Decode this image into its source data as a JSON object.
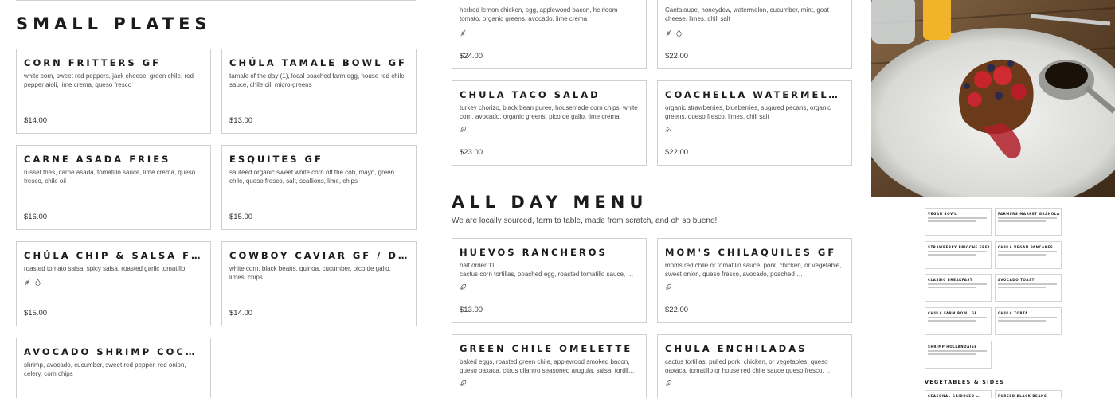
{
  "left_column": {
    "section_title": "SMALL PLATES",
    "items": [
      {
        "name": "CORN FRITTERS GF",
        "desc": "white corn, sweet red peppers, jack cheese, green chile, red pepper aioli, lime crema, queso fresco",
        "price": "$14.00"
      },
      {
        "name": "CHÚLA TAMALE BOWL  GF",
        "desc": "tamale of the day (1), local poached farm egg, house red chile sauce, chile oil, micro-greens",
        "price": "$13.00"
      },
      {
        "name": "CARNE ASADA FRIES",
        "desc": "russet fries, carne asada, tomatillo sauce, lime crema, queso fresco, chile oil",
        "price": "$16.00"
      },
      {
        "name": "ESQUITES  GF",
        "desc": "sautéed organic sweet white corn off the cob, mayo, green chile, queso fresco, salt, scallions, lime, chips",
        "price": "$15.00"
      },
      {
        "name": "CHÚLA CHIP & SALSA FLIGHT",
        "desc": "roasted tomato salsa, spicy salsa, roasted garlic tomatillo",
        "price": "$15.00"
      },
      {
        "name": "COWBOY CAVIAR  GF / DF / V",
        "desc": "white corn, black beans, quinoa, cucumber, pico de gallo, limes, chips",
        "price": "$14.00"
      },
      {
        "name": "AVOCADO SHRIMP COCKTAIL",
        "desc": "shrimp, avocado, cucumber, sweet red pepper, red onion, celery, corn chips",
        "price": ""
      }
    ]
  },
  "middle_column": {
    "top_items": [
      {
        "name": "",
        "desc": "herbed lemon chicken, egg, applewood bacon, heirloom tomato, organic greens, avocado, lime crema",
        "price": "$24.00"
      },
      {
        "name": "",
        "desc": "Cantaloupe, honeydew, watermelon, cucumber, mint, goat cheese, limes, chili salt",
        "price": "$22.00"
      },
      {
        "name": "CHULA TACO SALAD",
        "desc": "turkey chorizo, black bean puree, housemade corn chips, white corn, avocado, organic greens, pico de gallo, lime crema",
        "price": "$23.00"
      },
      {
        "name": "COACHELLA WATERMELON …",
        "desc": "organic strawberries, blueberries, sugared pecans, organic greens, queso fresco, limes, chili salt",
        "price": "$22.00"
      }
    ],
    "section_title": "ALL DAY MENU",
    "tagline": "We are locally sourced, farm to table, made from scratch, and oh so bueno!",
    "items": [
      {
        "name": "HUEVOS RANCHEROS",
        "desc": "half order 11\ncactus corn tortillas, poached egg, roasted tomatillo sauce, …",
        "price": "$13.00"
      },
      {
        "name": "MOM'S CHILAQUILES  GF",
        "desc": "moms red chile or tomatillo sauce, pork, chicken, or vegetable, sweet onion, queso fresco, avocado, poached …",
        "price": "$22.00"
      },
      {
        "name": "GREEN CHILE OMELETTE",
        "desc": "baked eggs, roasted green chile, applewood smoked bacon, queso oaxaca, citrus cilantro seasoned arugula, salsa, tortill…",
        "price": ""
      },
      {
        "name": "CHULA ENCHILADAS",
        "desc": "cactus tortillas, pulled pork, chicken, or vegetables, queso oaxaca, tomatillo or house red chile sauce queso fresco, …",
        "price": ""
      }
    ]
  },
  "right_column": {
    "mini_items": [
      {
        "name": "VEGAN BOWL"
      },
      {
        "name": "FARMERS MARKET GRANOLA …"
      },
      {
        "name": "STRAWBERRY BRIOCHE FRENCH…"
      },
      {
        "name": "CHULA VEGAN PANCAKES"
      },
      {
        "name": "CLASSIC BREAKFAST"
      },
      {
        "name": "AVOCADO TOAST"
      },
      {
        "name": "CHULA FARM BOWL  GF"
      },
      {
        "name": "CHULA  TORTA"
      },
      {
        "name": "SHRIMP HOLLANDAISE"
      }
    ],
    "veg_heading": "VEGETABLES & SIDES",
    "veg_items": [
      {
        "name": "SEASONAL GRIDDLED …"
      },
      {
        "name": "PUREED BLACK BEANS"
      }
    ]
  },
  "icons": {
    "vegan": "leaf-icon",
    "gluten_free": "wheat-icon",
    "dairy_free": "drop-icon"
  }
}
